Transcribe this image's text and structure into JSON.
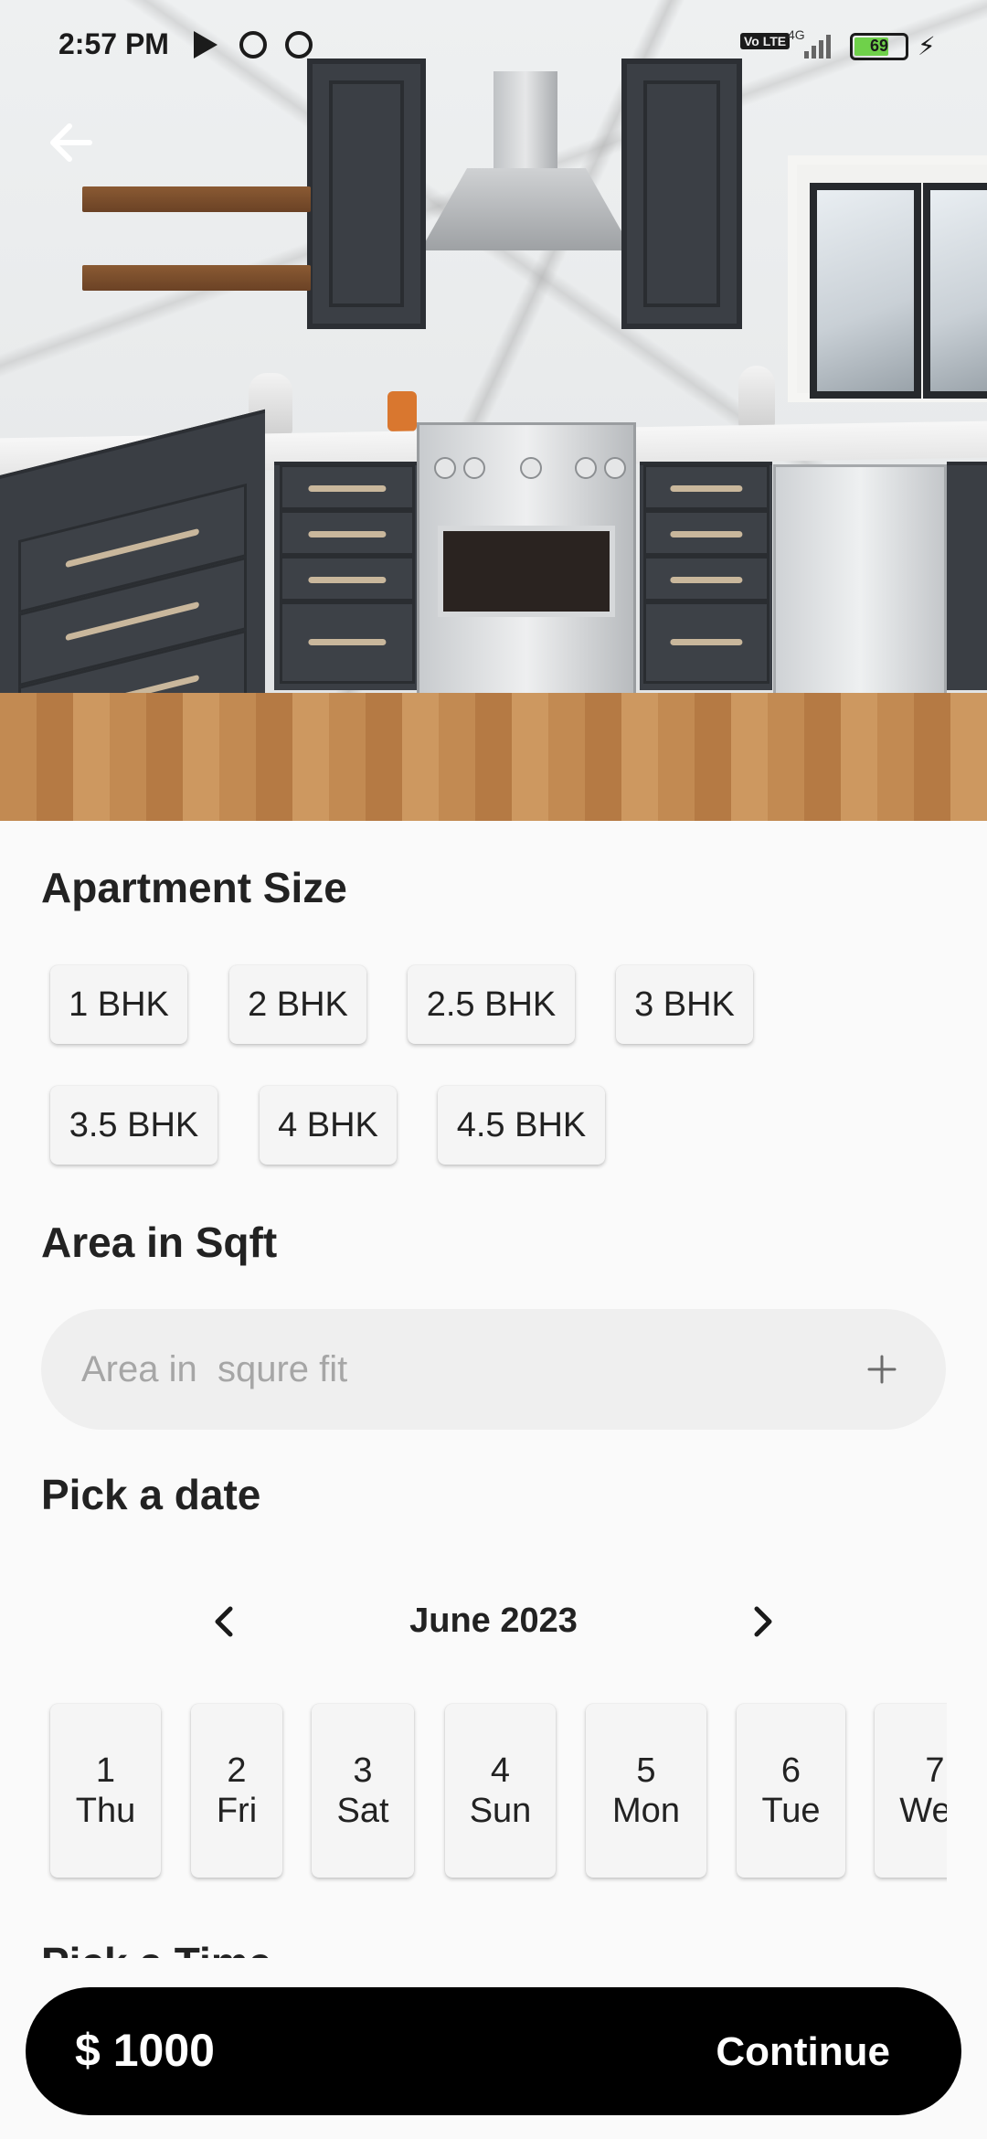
{
  "status_bar": {
    "time": "2:57 PM",
    "network": "4G",
    "battery": "69",
    "volte": "Vo LTE"
  },
  "icons": {
    "back": "back-arrow-icon",
    "play": "play-store-icon",
    "notify": "app-notification-icon",
    "add": "plus-icon",
    "prev": "chevron-left-icon",
    "next": "chevron-right-icon"
  },
  "apartment_size": {
    "title": "Apartment Size",
    "options": [
      "1 BHK",
      "2 BHK",
      "2.5 BHK",
      "3 BHK",
      "3.5 BHK",
      "4 BHK",
      "4.5 BHK"
    ]
  },
  "area": {
    "title": "Area in Sqft",
    "placeholder": "Area in  squre fit",
    "value": ""
  },
  "date_picker": {
    "title": "Pick a date",
    "month": "June 2023",
    "days": [
      {
        "num": "1",
        "day": "Thu"
      },
      {
        "num": "2",
        "day": "Fri"
      },
      {
        "num": "3",
        "day": "Sat"
      },
      {
        "num": "4",
        "day": "Sun"
      },
      {
        "num": "5",
        "day": "Mon"
      },
      {
        "num": "6",
        "day": "Tue"
      },
      {
        "num": "7",
        "day": "Wed"
      }
    ]
  },
  "time_picker": {
    "title": "Pick a Time"
  },
  "footer": {
    "price": "$ 1000",
    "continue_label": "Continue"
  },
  "colors": {
    "cta_bg": "#000000",
    "chip_bg": "#f5f5f5",
    "page_bg": "#fafafa",
    "battery": "#6fd14a"
  }
}
